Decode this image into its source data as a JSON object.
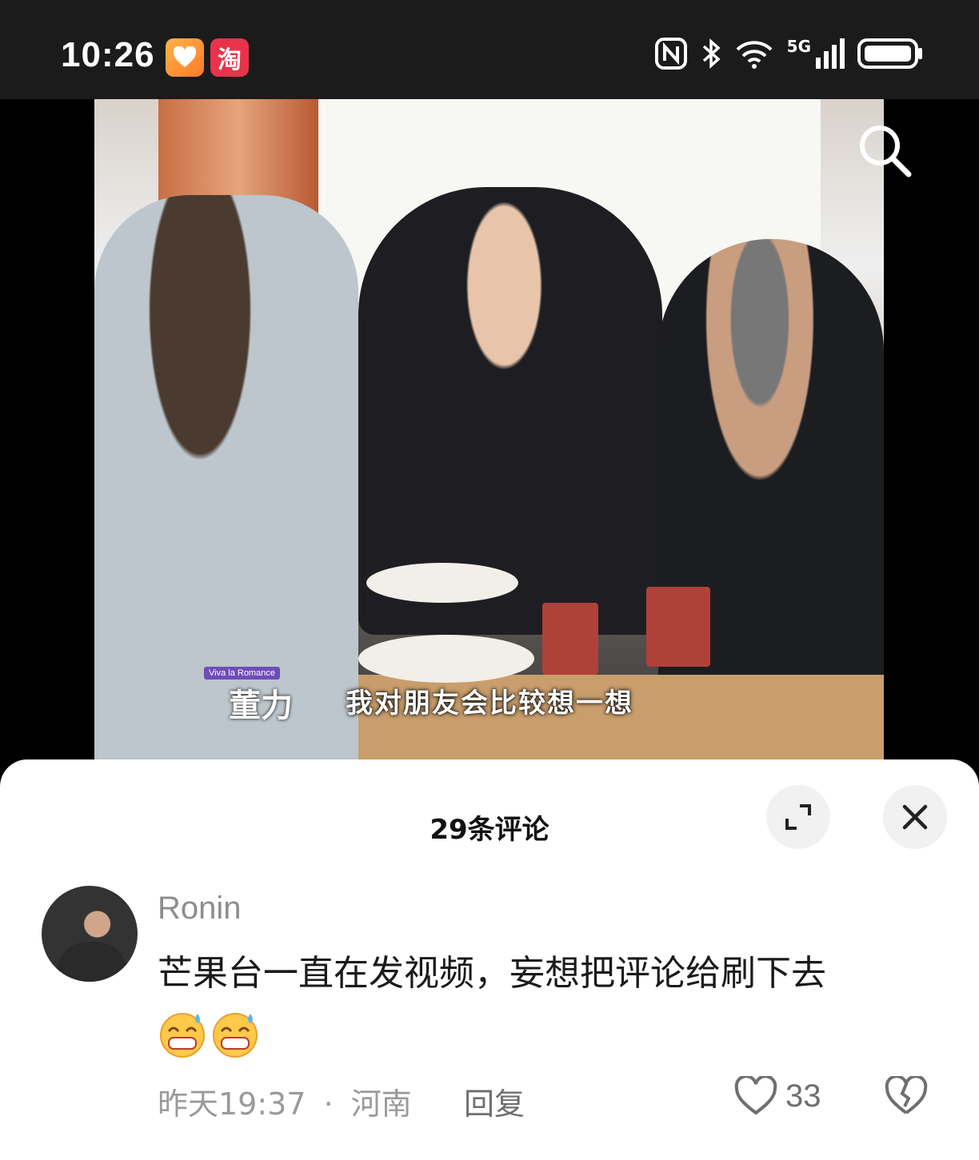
{
  "status_bar": {
    "time": "10:26",
    "apps": [
      "heart-app-icon",
      "taobao-icon"
    ],
    "taobao_label": "淘",
    "network": "5G",
    "icons": [
      "nfc-icon",
      "bluetooth-icon",
      "wifi-icon",
      "signal-icon",
      "battery-icon"
    ]
  },
  "video": {
    "name_tag_small": "Viva la Romance",
    "name_tag": "董力",
    "subtitle": "我对朋友会比较想一想"
  },
  "comments_panel": {
    "title": "29条评论",
    "comment": {
      "author": "Ronin",
      "text": "芒果台一直在发视频，妄想把评论给刷下去",
      "emojis": [
        "grinning-sweat-emoji",
        "grinning-sweat-emoji"
      ],
      "time": "昨天19:37",
      "separator": "·",
      "location": "河南",
      "reply_label": "回复",
      "likes": "33"
    }
  },
  "colors": {
    "status_bar_bg": "#1b1b1b",
    "sheet_bg": "#ffffff",
    "muted_text": "#9a9a9a",
    "button_bg": "#f1f1f1"
  }
}
